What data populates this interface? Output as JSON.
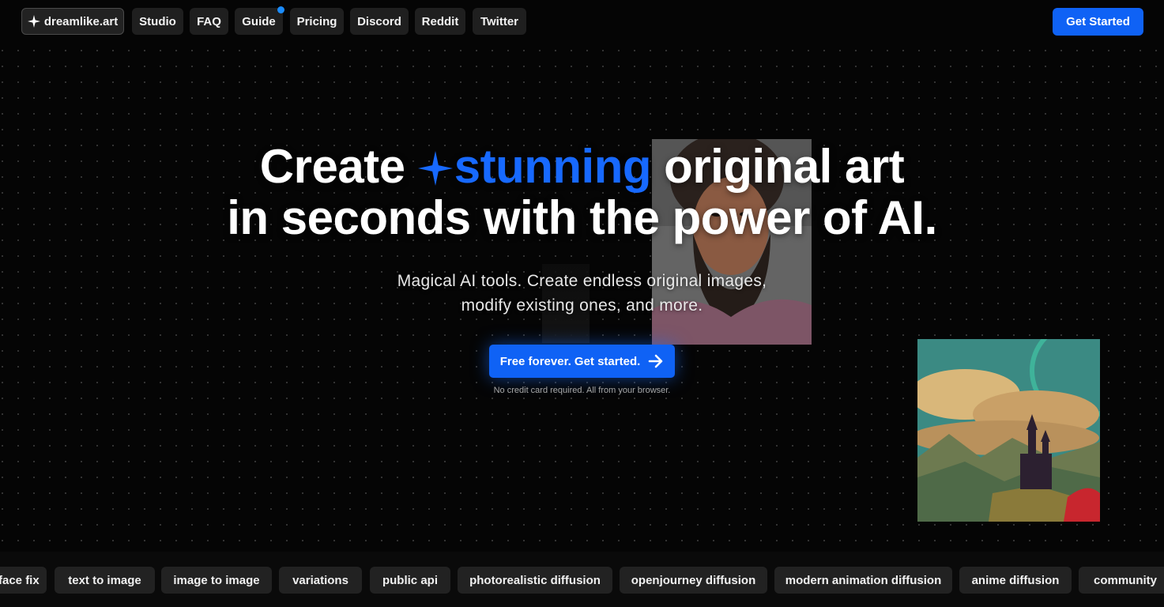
{
  "nav": {
    "logo_label": "dreamlike.art",
    "items": [
      "Studio",
      "FAQ",
      "Guide",
      "Pricing",
      "Discord",
      "Reddit",
      "Twitter"
    ],
    "cta_label": "Get Started"
  },
  "hero": {
    "title_word_1": "Create",
    "title_accent": "stunning",
    "title_rest_1": "original art",
    "title_line_2": "in seconds with the power of AI.",
    "subtitle_line_1": "Magical AI tools. Create endless original images,",
    "subtitle_line_2": "modify existing ones, and more.",
    "cta_label": "Free forever. Get started.",
    "note": "No credit card required. All from your browser."
  },
  "features": {
    "tags": [
      "face fix",
      "text to image",
      "image to image",
      "variations",
      "public api",
      "photorealistic diffusion",
      "openjourney diffusion",
      "modern animation diffusion",
      "anime diffusion",
      "community"
    ]
  },
  "colors": {
    "accent": "#0f62f5",
    "accent_text": "#1769ff",
    "background": "#050505",
    "pill": "#1f1f1f"
  },
  "icons": {
    "logo": "sparkle-icon",
    "title_star": "sparkle-icon",
    "cta_arrow": "arrow-right-icon"
  }
}
